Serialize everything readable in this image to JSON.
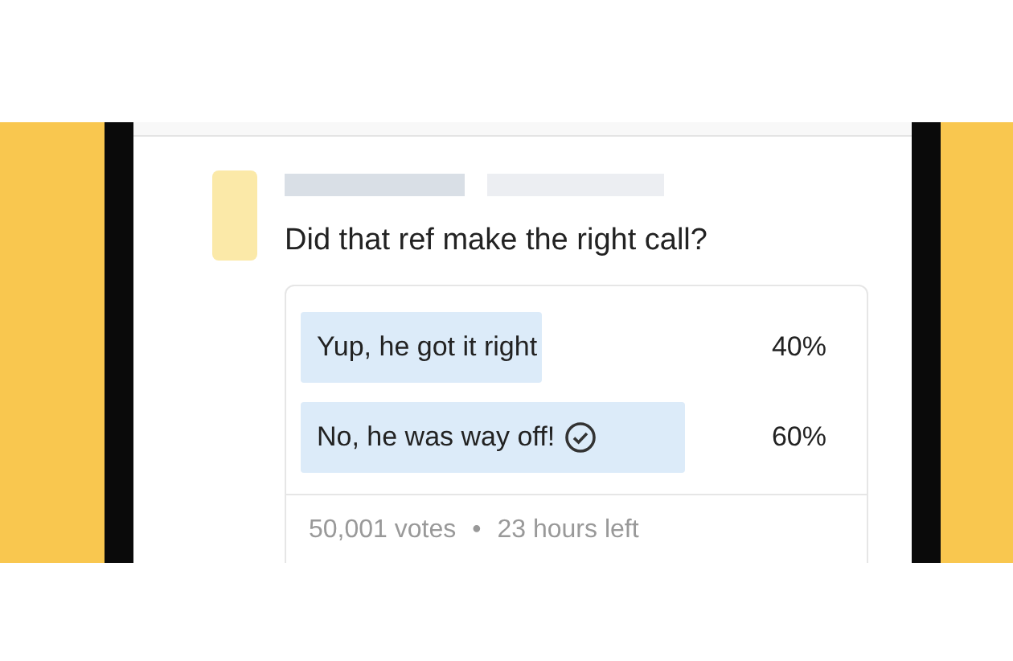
{
  "post": {
    "question": "Did that ref make the right call?"
  },
  "poll": {
    "options": [
      {
        "label": "Yup, he got it right",
        "percent": "40%",
        "level": 0.44,
        "selected": false
      },
      {
        "label": "No, he was way off!",
        "percent": "60%",
        "level": 0.7,
        "selected": true
      }
    ],
    "footer": {
      "votes": "50,001 votes",
      "separator": "•",
      "time_left": "23 hours left"
    }
  }
}
